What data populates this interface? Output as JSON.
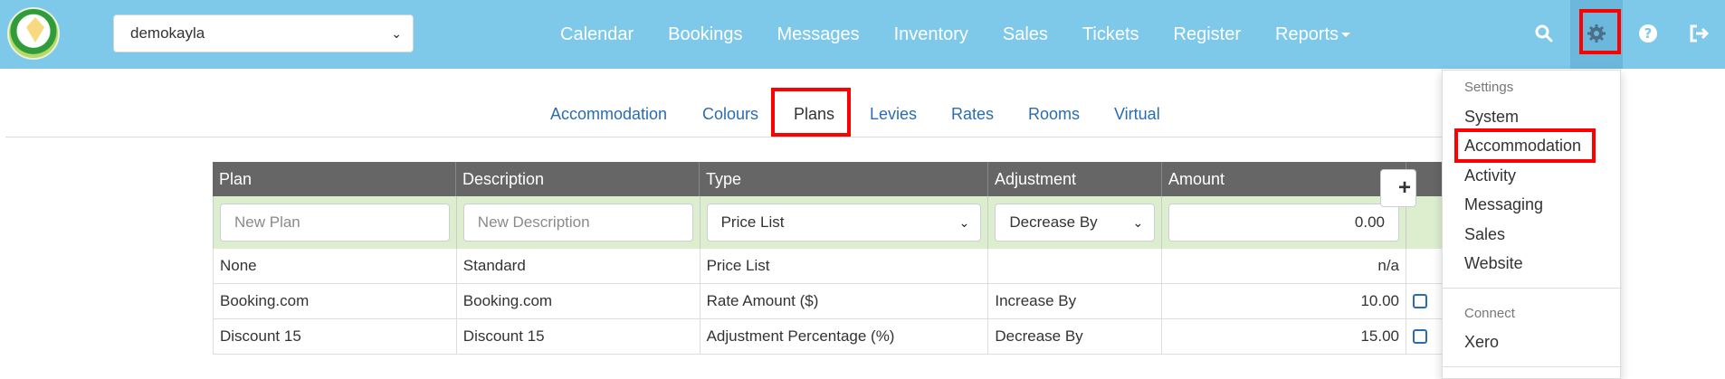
{
  "topbar": {
    "account": "demokayla",
    "nav": [
      "Calendar",
      "Bookings",
      "Messages",
      "Inventory",
      "Sales",
      "Tickets",
      "Register",
      "Reports"
    ],
    "icons": [
      "search-icon",
      "gear-icon",
      "help-icon",
      "logout-icon"
    ],
    "background": "#7ec8ea"
  },
  "tabs": [
    "Accommodation",
    "Colours",
    "Plans",
    "Levies",
    "Rates",
    "Rooms",
    "Virtual"
  ],
  "active_tab": "Plans",
  "table": {
    "columns": [
      "Plan",
      "Description",
      "Type",
      "Adjustment",
      "Amount"
    ],
    "new_row": {
      "plan_placeholder": "New Plan",
      "description_placeholder": "New Description",
      "type": "Price List",
      "adjustment": "Decrease By",
      "amount": "0.00"
    },
    "rows": [
      {
        "plan": "None",
        "description": "Standard",
        "type": "Price List",
        "adjustment": "",
        "amount": "n/a"
      },
      {
        "plan": "Booking.com",
        "description": "Booking.com",
        "type": "Rate Amount ($)",
        "adjustment": "Increase By",
        "amount": "10.00"
      },
      {
        "plan": "Discount 15",
        "description": "Discount 15",
        "type": "Adjustment Percentage (%)",
        "adjustment": "Decrease By",
        "amount": "15.00"
      }
    ]
  },
  "dropdown": {
    "settings_header": "Settings",
    "settings_items": [
      "System",
      "Accommodation",
      "Activity",
      "Messaging",
      "Sales",
      "Website"
    ],
    "connect_header": "Connect",
    "connect_items": [
      "Xero"
    ]
  },
  "highlight_color": "#ff0000"
}
